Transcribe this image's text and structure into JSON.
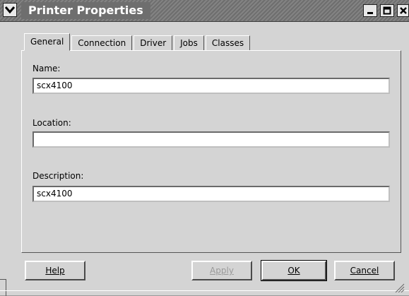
{
  "window": {
    "title": "Printer Properties"
  },
  "tabs": [
    {
      "label": "General",
      "active": true
    },
    {
      "label": "Connection",
      "active": false
    },
    {
      "label": "Driver",
      "active": false
    },
    {
      "label": "Jobs",
      "active": false
    },
    {
      "label": "Classes",
      "active": false
    }
  ],
  "fields": {
    "name_label": "Name:",
    "name_value": "scx4100",
    "location_label": "Location:",
    "location_value": "",
    "description_label": "Description:",
    "description_value": "scx4100"
  },
  "buttons": {
    "help": "Help",
    "apply": "Apply",
    "ok": "OK",
    "cancel": "Cancel"
  },
  "icons": {
    "menu": "chevron-down-icon",
    "minimize": "minimize-icon",
    "maximize": "maximize-icon",
    "close": "close-icon"
  }
}
